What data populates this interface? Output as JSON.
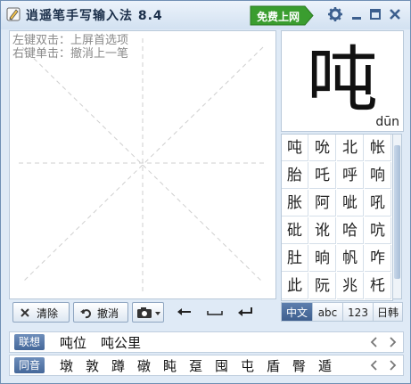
{
  "window": {
    "title": "逍遥笔手写输入法 8.4",
    "free_internet": "免费上网"
  },
  "pad": {
    "hint_line1": "左键双击：上屏首选项",
    "hint_line2": "右键单击：撤消上一笔",
    "clear_label": "清除",
    "undo_label": "撤消"
  },
  "preview": {
    "char": "吨",
    "pinyin": "dūn"
  },
  "candidates": [
    "吨",
    "吮",
    "北",
    "帐",
    "胎",
    "吒",
    "呼",
    "响",
    "胀",
    "阿",
    "呲",
    "吼",
    "砒",
    "讹",
    "哈",
    "吭",
    "肚",
    "晌",
    "帆",
    "咋",
    "此",
    "阮",
    "兆",
    "杔"
  ],
  "modes": [
    {
      "label": "中文",
      "active": true
    },
    {
      "label": "abc",
      "active": false
    },
    {
      "label": "123",
      "active": false
    },
    {
      "label": "日韩",
      "active": false
    }
  ],
  "association": {
    "label": "联想",
    "words": [
      "吨位",
      "吨公里"
    ]
  },
  "homophone": {
    "label": "同音",
    "words": [
      "墩",
      "敦",
      "蹲",
      "礅",
      "盹",
      "趸",
      "囤",
      "屯",
      "盾",
      "臀",
      "遁"
    ]
  },
  "colors": {
    "accent": "#4a6d9f",
    "green": "#3a9d2f"
  }
}
